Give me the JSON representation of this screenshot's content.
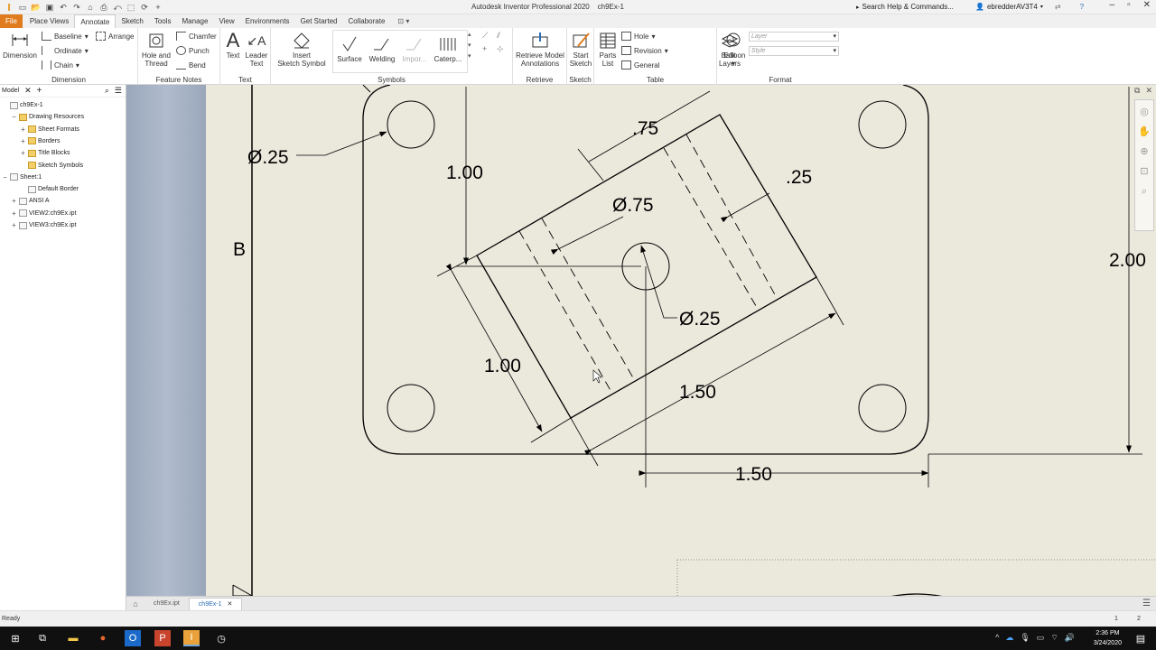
{
  "app": {
    "title": "Autodesk Inventor Professional 2020",
    "doc_title": "ch9Ex-1",
    "search_placeholder": "Search Help & Commands...",
    "user": "ebredderAV3T4"
  },
  "menu": {
    "tabs": [
      "File",
      "Place Views",
      "Annotate",
      "Sketch",
      "Tools",
      "Manage",
      "View",
      "Environments",
      "Get Started",
      "Collaborate"
    ],
    "active": "Annotate"
  },
  "ribbon": {
    "dimension": {
      "big_label": "Dimension",
      "baseline": "Baseline",
      "arrange": "Arrange",
      "ordinate": "Ordinate",
      "chain": "Chain",
      "panel": "Dimension"
    },
    "feature_notes": {
      "hole_line1": "Hole and",
      "hole_line2": "Thread",
      "chamfer": "Chamfer",
      "punch": "Punch",
      "bend": "Bend",
      "panel": "Feature Notes"
    },
    "text": {
      "text": "Text",
      "leader_line1": "Leader",
      "leader_line2": "Text",
      "panel": "Text"
    },
    "symbols": {
      "insert_line1": "Insert",
      "insert_line2": "Sketch Symbol",
      "surface": "Surface",
      "welding": "Welding",
      "import": "Impor...",
      "caterpillar": "Caterp...",
      "panel": "Symbols"
    },
    "retrieve": {
      "line1": "Retrieve Model",
      "line2": "Annotations",
      "panel": "Retrieve"
    },
    "sketch": {
      "line1": "Start",
      "line2": "Sketch",
      "panel": "Sketch"
    },
    "table": {
      "parts_line1": "Parts",
      "parts_line2": "List",
      "hole": "Hole",
      "revision": "Revision",
      "general": "General",
      "panel": "Table"
    },
    "format": {
      "balloon": "Balloon",
      "edit_line1": "Edit",
      "edit_line2": "Layers",
      "layer_placeholder": "Layer",
      "style_placeholder": "Style",
      "panel": "Format"
    }
  },
  "browser": {
    "tab": "Model",
    "items": [
      {
        "label": "ch9Ex-1",
        "indent": 0,
        "exp": "",
        "icon": "drawing"
      },
      {
        "label": "Drawing Resources",
        "indent": 1,
        "exp": "−",
        "icon": "folder"
      },
      {
        "label": "Sheet Formats",
        "indent": 2,
        "exp": "+",
        "icon": "folder"
      },
      {
        "label": "Borders",
        "indent": 2,
        "exp": "+",
        "icon": "folder"
      },
      {
        "label": "Title Blocks",
        "indent": 2,
        "exp": "+",
        "icon": "folder"
      },
      {
        "label": "Sketch Symbols",
        "indent": 2,
        "exp": "",
        "icon": "folder"
      },
      {
        "label": "Sheet:1",
        "indent": 0,
        "exp": "−",
        "icon": "sheet"
      },
      {
        "label": "Default Border",
        "indent": 2,
        "exp": "",
        "icon": "sheet"
      },
      {
        "label": "ANSI A",
        "indent": 1,
        "exp": "+",
        "icon": "sheet"
      },
      {
        "label": "VIEW2:ch9Ex.ipt",
        "indent": 1,
        "exp": "+",
        "icon": "view"
      },
      {
        "label": "VIEW3:ch9Ex.ipt",
        "indent": 1,
        "exp": "+",
        "icon": "view"
      }
    ]
  },
  "drawing": {
    "zone_letter": "B",
    "dims": {
      "hole_dia_top_left": "Ø.25",
      "vertical_1_00": "1.00",
      "top_75": ".75",
      "right_25": ".25",
      "center_bore": "Ø.75",
      "center_hole": "Ø.25",
      "left_1_00": "1.00",
      "bottom_1_50": "1.50",
      "horizontal_1_50": "1.50",
      "height_2_00": "2.00"
    }
  },
  "doctabs": [
    "ch9Ex.ipt",
    "ch9Ex-1"
  ],
  "status": {
    "ready": "Ready",
    "n1": "1",
    "n2": "2"
  },
  "taskbar": {
    "time": "2:36 PM",
    "date": "3/24/2020"
  }
}
